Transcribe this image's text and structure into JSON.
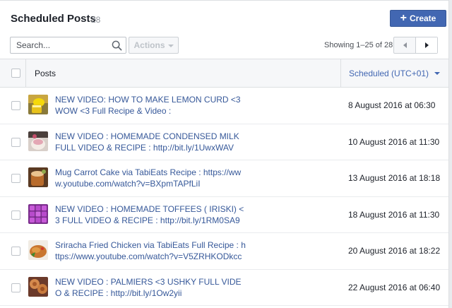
{
  "header": {
    "title": "Scheduled Posts",
    "count": "28",
    "create_label": "Create"
  },
  "toolbar": {
    "search_placeholder": "Search...",
    "actions_label": "Actions",
    "showing": "Showing 1–25 of 28"
  },
  "table": {
    "col_posts": "Posts",
    "col_scheduled": "Scheduled (UTC+01)",
    "rows": [
      {
        "text": "NEW VIDEO: HOW TO MAKE LEMON CURD <3 WOW <3 Full Recipe & Video :",
        "date": "8 August 2016 at 06:30",
        "thumb": "lemon-curd"
      },
      {
        "text": "NEW VIDEO : HOMEMADE CONDENSED MILK FULL VIDEO & RECIPE : http://bit.ly/1UwxWAV",
        "date": "10 August 2016 at 11:30",
        "thumb": "condensed-milk"
      },
      {
        "text": "Mug Carrot Cake via TabiEats Recipe : https://www.youtube.com/watch?v=BXpmTAPfLiI",
        "date": "13 August 2016 at 18:18",
        "thumb": "carrot-cake"
      },
      {
        "text": "NEW VIDEO : HOMEMADE TOFFEES ( IRISKI) <3 FULL VIDEO & RECIPE : http://bit.ly/1RM0SA9",
        "date": "18 August 2016 at 11:30",
        "thumb": "toffees"
      },
      {
        "text": "Sriracha Fried Chicken via TabiEats Full Recipe : https://www.youtube.com/watch?v=V5ZRHKODkcc",
        "date": "20 August 2016 at 18:22",
        "thumb": "fried-chicken"
      },
      {
        "text": "NEW VIDEO : PALMIERS <3 USHKY FULL VIDEO & RECIPE : http://bit.ly/1Ow2yii",
        "date": "22 August 2016 at 06:40",
        "thumb": "palmiers"
      }
    ]
  },
  "colors": {
    "accent": "#4267b2",
    "link": "#365899"
  }
}
